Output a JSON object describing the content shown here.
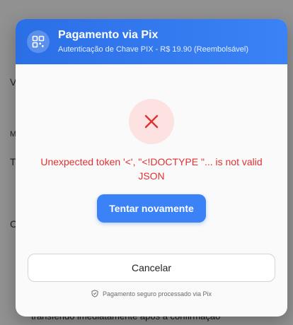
{
  "background": {
    "fragments": [
      "V",
      "M",
      "T",
      "C"
    ],
    "bottom_text": "transferido imediatamente após a confirmação"
  },
  "modal": {
    "header": {
      "title": "Pagamento via Pix",
      "subtitle": "Autenticação de Chave PIX - R$ 19.90 (Reembolsável)",
      "icon": "qr-code-icon"
    },
    "error": {
      "icon": "close-x-icon",
      "message": "Unexpected token '<', \"<!DOCTYPE \"... is not valid JSON"
    },
    "retry_label": "Tentar novamente",
    "cancel_label": "Cancelar",
    "secure_note": "Pagamento seguro processado via Pix",
    "secure_icon": "shield-check-icon"
  },
  "colors": {
    "header_blue": "#3b82f6",
    "error_red": "#e03131",
    "error_bg": "#fde2e2"
  }
}
